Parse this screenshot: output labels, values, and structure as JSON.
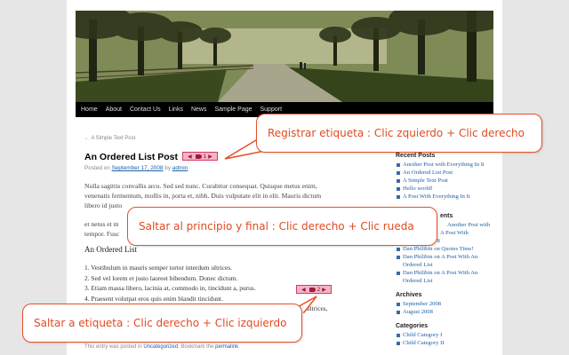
{
  "nav": {
    "items": [
      "Home",
      "About",
      "Contact Us",
      "Links",
      "News",
      "Sample Page",
      "Support"
    ]
  },
  "breadcrumb": "← A Simple Text Post",
  "post": {
    "title": "An Ordered List Post",
    "meta_prefix": "Posted on",
    "date": "September 17, 2008",
    "by": "by",
    "author": "admin",
    "paragraph_lines": [
      "Nulla sagittis convallis arcu. Sed sed nunc. Curabitur consequat. Quisque metus enim,",
      "venenatis fermentum, mollis in, porta et, nibh. Duis vulputate elit in elit. Mauris dictum",
      "libero id justo",
      "et netus et m",
      "tempor. Fusc"
    ],
    "ordered_list_heading": "An Ordered List",
    "list_items": [
      "1.  Vestibulum in mauris semper tortor interdum ultrices.",
      "2.  Sed vel lorem et justo laoreet bibendum. Donec dictum.",
      "3.  Etiam massa libero, lacinia at, commodo in, tincidunt a, purus.",
      "4.  Praesent volutpat eros quis enim blandit tincidunt.",
      "gestas ultrices,"
    ],
    "footer_text": "This entry was posted in",
    "footer_link": "Uncategorized",
    "footer_mid": ". Bookmark the",
    "footer_permalink": "permalink",
    "footer_end": "."
  },
  "tags": {
    "tag1": "1",
    "tag2": "2",
    "left_arrow": "◀",
    "right_arrow": "▶"
  },
  "sidebar": {
    "recent_posts_heading": "Recent Posts",
    "recent_posts": [
      "Another Post with Everything In It",
      "An Ordered List Post",
      "A Simple Text Post",
      "Hello world!",
      "A Post With Everything In It"
    ],
    "comments_heading_fragment": "ents",
    "comments": [
      {
        "author": "",
        "text": "Another Post with"
      },
      {
        "author": "",
        "text": "A Post With"
      },
      {
        "author": "",
        "text": "Everything In It"
      },
      {
        "author": "Dan Philibin",
        "text": "on Quotes Time!"
      },
      {
        "author": "Dan Philibin",
        "text": "on A Post With An Ordered List"
      },
      {
        "author": "Dan Philibin",
        "text": "on A Post With An Ordered List"
      }
    ],
    "archives_heading": "Archives",
    "archives": [
      "September 2008",
      "August 2008"
    ],
    "categories_heading": "Categories",
    "categories": [
      "Child Category I",
      "Child Category II"
    ]
  },
  "callouts": {
    "register_tag": "Registrar etiqueta : Clic zquierdo + Clic derecho",
    "jump_start_end": "Saltar al principio y final : Clic derecho + Clic rueda",
    "jump_to_tag": "Saltar a etiqueta : Clic derecho + Clic izquierdo"
  },
  "colors": {
    "callout_border": "#e8502a",
    "callout_text": "#e14a20",
    "tag_fill": "#f7b3c6",
    "tag_border": "#d23c62",
    "link": "#1d5fa8"
  }
}
